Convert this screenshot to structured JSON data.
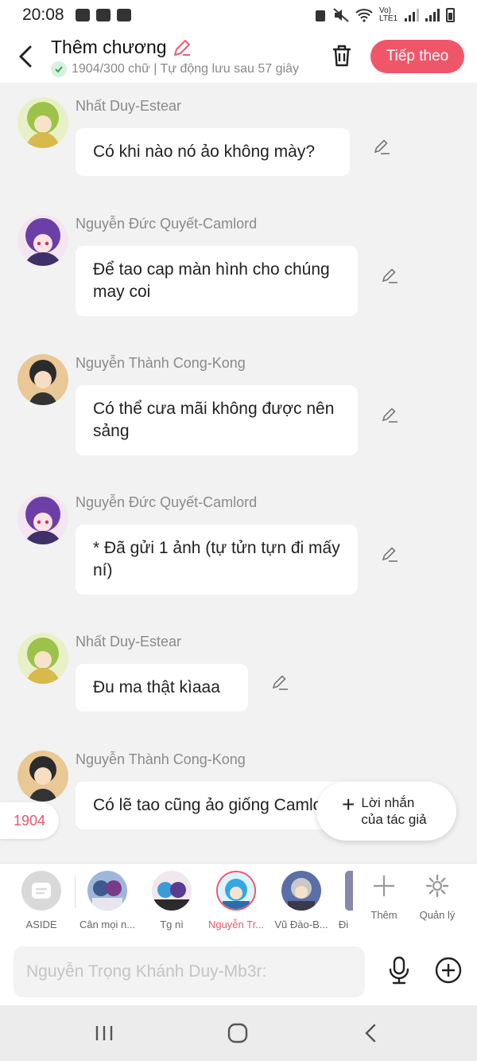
{
  "status_bar": {
    "time": "20:08",
    "network": "Vo) LTE1"
  },
  "header": {
    "title": "Thêm chương",
    "subtitle": "1904/300 chữ | Tự động lưu sau 57 giây",
    "next_label": "Tiếp theo"
  },
  "messages": [
    {
      "sender": "Nhất Duy-Estear",
      "text": "Có khi nào nó ảo không mày?"
    },
    {
      "sender": "Nguyễn Đức Quyết-Camlord",
      "text": "Để tao cap màn hình cho chúng may coi"
    },
    {
      "sender": "Nguyễn Thành Cong-Kong",
      "text": "Có thể cưa mãi không được nên sảng"
    },
    {
      "sender": "Nguyễn Đức Quyết-Camlord",
      "text": "* Đã gửi 1 ảnh (tự tửn tựn đi mấy ní)"
    },
    {
      "sender": "Nhất Duy-Estear",
      "text": "Đu ma thật kìaaa"
    },
    {
      "sender": "Nguyễn Thành Cong-Kong",
      "text": "Có lẽ tao cũng ảo giống Camlord"
    }
  ],
  "counter": "1904",
  "author_note": {
    "label": "Lời nhắn của tác giả"
  },
  "characters": [
    {
      "name": "ASIDE"
    },
    {
      "name": "Cân mọi n..."
    },
    {
      "name": "Tg nì"
    },
    {
      "name": "Nguyễn Tr..."
    },
    {
      "name": "Vũ Đào-B..."
    },
    {
      "name": "Đi"
    }
  ],
  "tools": {
    "add": "Thêm",
    "manage": "Quản lý"
  },
  "composer": {
    "placeholder": "Nguyễn Trọng Khánh Duy-Mb3r:"
  },
  "colors": {
    "accent": "#f0566a",
    "background": "#f2f2f2"
  }
}
